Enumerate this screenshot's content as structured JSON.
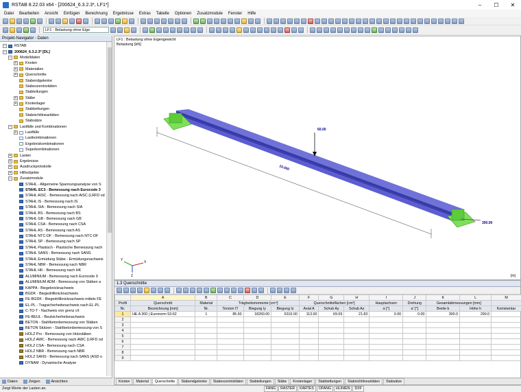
{
  "window": {
    "title": "RSTAB 8.22.03 x64 - [200624_6.3.2.3*, LF1*]",
    "minimize": "–",
    "maximize": "☐",
    "close": "✕"
  },
  "menu": [
    "Datei",
    "Bearbeiten",
    "Ansicht",
    "Einfügen",
    "Berechnung",
    "Ergebnisse",
    "Extras",
    "Tabelle",
    "Optionen",
    "Zusatzmodule",
    "Fenster",
    "Hilfe"
  ],
  "toolbar": {
    "loadcase": "LF1 - Belastung ohne Eige"
  },
  "navigator": {
    "title": "Projekt-Navigator - Daten",
    "tree": [
      {
        "label": "RSTAB",
        "lvl": 0,
        "ic": "m",
        "ex": "−"
      },
      {
        "label": "200624_6.3.2.3* [DL]",
        "lvl": 0,
        "ic": "m",
        "ex": "−",
        "b": true
      },
      {
        "label": "Modelldaten",
        "lvl": 1,
        "ic": "f",
        "ex": "−"
      },
      {
        "label": "Knoten",
        "lvl": 2,
        "ic": "f",
        "ex": "+"
      },
      {
        "label": "Materialien",
        "lvl": 2,
        "ic": "f",
        "ex": "+"
      },
      {
        "label": "Querschnitte",
        "lvl": 2,
        "ic": "f",
        "ex": "+"
      },
      {
        "label": "Stabendgelenke",
        "lvl": 2,
        "ic": "f"
      },
      {
        "label": "Stabexzentrizitäten",
        "lvl": 2,
        "ic": "f"
      },
      {
        "label": "Stabteilungen",
        "lvl": 2,
        "ic": "f"
      },
      {
        "label": "Stäbe",
        "lvl": 2,
        "ic": "f",
        "ex": "+"
      },
      {
        "label": "Knotenlager",
        "lvl": 2,
        "ic": "f",
        "ex": "+"
      },
      {
        "label": "Stabbettungen",
        "lvl": 2,
        "ic": "f"
      },
      {
        "label": "Stabnichtlinearitäten",
        "lvl": 2,
        "ic": "f"
      },
      {
        "label": "Stabsätze",
        "lvl": 2,
        "ic": "f"
      },
      {
        "label": "Lastfälle und Kombinationen",
        "lvl": 1,
        "ic": "f",
        "ex": "−"
      },
      {
        "label": "Lastfälle",
        "lvl": 2,
        "ic": "d",
        "ex": "+"
      },
      {
        "label": "Lastkombinationen",
        "lvl": 2,
        "ic": "d"
      },
      {
        "label": "Ergebniskombinationen",
        "lvl": 2,
        "ic": "d"
      },
      {
        "label": "Superkombinationen",
        "lvl": 2,
        "ic": "d"
      },
      {
        "label": "Lasten",
        "lvl": 1,
        "ic": "f",
        "ex": "+"
      },
      {
        "label": "Ergebnisse",
        "lvl": 1,
        "ic": "f",
        "ex": "+"
      },
      {
        "label": "Ausdruckprotokolle",
        "lvl": 1,
        "ic": "f",
        "ex": "+"
      },
      {
        "label": "Hilfsobjekte",
        "lvl": 1,
        "ic": "f",
        "ex": "+"
      },
      {
        "label": "Zusatzmodule",
        "lvl": 1,
        "ic": "f",
        "ex": "−"
      },
      {
        "label": "STAHL - Allgemeine Spannungsanalyse von S",
        "lvl": 2,
        "ic": "m"
      },
      {
        "label": "STAHL EC3 - Bemessung nach Eurocode 3",
        "lvl": 2,
        "ic": "m",
        "b": true
      },
      {
        "label": "STAHL AISC - Bemessung nach AISC (LRFD od",
        "lvl": 2,
        "ic": "m"
      },
      {
        "label": "STAHL IS - Bemessung nach IS",
        "lvl": 2,
        "ic": "m"
      },
      {
        "label": "STAHL SIA - Bemessung nach SIA",
        "lvl": 2,
        "ic": "m"
      },
      {
        "label": "STAHL BS - Bemessung nach BS",
        "lvl": 2,
        "ic": "m"
      },
      {
        "label": "STAHL GB - Bemessung nach GB",
        "lvl": 2,
        "ic": "m"
      },
      {
        "label": "STAHL CSA - Bemessung nach CSA",
        "lvl": 2,
        "ic": "m"
      },
      {
        "label": "STAHL AS - Bemessung nach AS",
        "lvl": 2,
        "ic": "m"
      },
      {
        "label": "STAHL NTC-DF - Bemessung nach NTC-DF",
        "lvl": 2,
        "ic": "m"
      },
      {
        "label": "STAHL SP - Bemessung nach SP",
        "lvl": 2,
        "ic": "m"
      },
      {
        "label": "STAHL Plastisch - Plastische Bemessung nach",
        "lvl": 2,
        "ic": "m"
      },
      {
        "label": "STAHL SANS - Bemessung nach SANS",
        "lvl": 2,
        "ic": "m"
      },
      {
        "label": "STAHL Ermüdung Stäbe - Ermüdungsnachweis",
        "lvl": 2,
        "ic": "m"
      },
      {
        "label": "STAHL NBR - Bemessung nach NBR",
        "lvl": 2,
        "ic": "m"
      },
      {
        "label": "STAHL HK - Bemessung nach HK",
        "lvl": 2,
        "ic": "m"
      },
      {
        "label": "ALUMINIUM - Bemessung nach Eurocode 9",
        "lvl": 2,
        "ic": "m"
      },
      {
        "label": "ALUMINIUM ADM - Bemessung von Stäben a",
        "lvl": 2,
        "ic": "m"
      },
      {
        "label": "KAPPA - Biegeknicknachweis",
        "lvl": 2,
        "ic": "m"
      },
      {
        "label": "BGDK - Biegedrillknicknachweis",
        "lvl": 2,
        "ic": "m"
      },
      {
        "label": "FE-BGDK - Biegedrillknicknachweis mittels FE",
        "lvl": 2,
        "ic": "m"
      },
      {
        "label": "EL-PL - Tragsicherheitsnachweis nach EL-PL",
        "lvl": 2,
        "ic": "m"
      },
      {
        "label": "C-TO-T - Nachweis von grenz c/t",
        "lvl": 2,
        "ic": "m"
      },
      {
        "label": "FE-BEUL - Beulsicherheitsnachweis",
        "lvl": 2,
        "ic": "m"
      },
      {
        "label": "BETON - Stahlbetonbemessung von Stäben",
        "lvl": 2,
        "ic": "m"
      },
      {
        "label": "BETON Stützen - Stahlbetonbemessung von S",
        "lvl": 2,
        "ic": "m"
      },
      {
        "label": "HOLZ Pro - Bemessung von Holzstäben",
        "lvl": 2,
        "ic": "p"
      },
      {
        "label": "HOLZ AWC - Bemessung nach AWC (LRFD od",
        "lvl": 2,
        "ic": "p"
      },
      {
        "label": "HOLZ CSA - Bemessung nach CSA",
        "lvl": 2,
        "ic": "p"
      },
      {
        "label": "HOLZ NBR - Bemessung nach NBR",
        "lvl": 2,
        "ic": "p"
      },
      {
        "label": "HOLZ SANS - Bemessung nach SANS (ASD o",
        "lvl": 2,
        "ic": "p"
      },
      {
        "label": "DYNAM - Dynamische Analyse",
        "lvl": 2,
        "ic": "m"
      }
    ],
    "tabs": [
      "Daten",
      "Zeigen",
      "Ansichten"
    ]
  },
  "view": {
    "line1": "LF1 : Belastung ohne Eigengewicht",
    "line2": "Belastung [kN]",
    "load_p": "60.00",
    "dim": "10.000",
    "load_end": "300.00",
    "unit": "[m]",
    "axis_x": "X",
    "axis_y": "Y",
    "axis_z": "Z"
  },
  "panel": {
    "title": "1.3 Querschnitte",
    "col_letters": [
      "A",
      "B",
      "C",
      "D",
      "E",
      "F",
      "G",
      "H",
      "I",
      "J",
      "K",
      "L",
      "M"
    ],
    "head1": [
      "Profil",
      "Querschnitt",
      "Material",
      "Trägheitsmomente [cm⁴]",
      "Querschnittsflächen [cm²]",
      "Hauptachsen",
      "Drehung",
      "Gesamtabmessungen [mm]",
      ""
    ],
    "head2": [
      "Nr.",
      "Bezeichnung [mm]",
      "Nr.",
      "Torsion IT",
      "Biegung Iy",
      "Biegung Iz",
      "Axial A",
      "Schub Ay",
      "Schub Az",
      "α [°]",
      "α' [°]",
      "Breite b",
      "Höhe h",
      "Kommentar"
    ],
    "rows": [
      [
        "1",
        "HE A 300 | Euronorm 53-62",
        "1",
        "85.60",
        "18260.00",
        "6310.00",
        "113.00",
        "69.09",
        "21.83",
        "0.00",
        "0.00",
        "300.0",
        "290.0",
        ""
      ],
      [
        "2",
        "",
        "",
        "",
        "",
        "",
        "",
        "",
        "",
        "",
        "",
        "",
        "",
        ""
      ],
      [
        "3",
        "",
        "",
        "",
        "",
        "",
        "",
        "",
        "",
        "",
        "",
        "",
        "",
        ""
      ],
      [
        "4",
        "",
        "",
        "",
        "",
        "",
        "",
        "",
        "",
        "",
        "",
        "",
        "",
        ""
      ],
      [
        "5",
        "",
        "",
        "",
        "",
        "",
        "",
        "",
        "",
        "",
        "",
        "",
        "",
        ""
      ],
      [
        "6",
        "",
        "",
        "",
        "",
        "",
        "",
        "",
        "",
        "",
        "",
        "",
        "",
        ""
      ],
      [
        "7",
        "",
        "",
        "",
        "",
        "",
        "",
        "",
        "",
        "",
        "",
        "",
        "",
        ""
      ],
      [
        "8",
        "",
        "",
        "",
        "",
        "",
        "",
        "",
        "",
        "",
        "",
        "",
        "",
        ""
      ],
      [
        "9",
        "",
        "",
        "",
        "",
        "",
        "",
        "",
        "",
        "",
        "",
        "",
        "",
        ""
      ]
    ],
    "tabs": [
      "Knoten",
      "Material",
      "Querschnitte",
      "Stabendgelenke",
      "Stabexzentrizitäten",
      "Stabteilungen",
      "Stäbe",
      "Knotenlager",
      "Stabbettungen",
      "Stabnichtlinearitäten",
      "Stabsätze"
    ],
    "active_tab": "Querschnitte"
  },
  "status": {
    "text": "Zeigt Werte der Lasten an.",
    "buttons": [
      "FANG",
      "RASTER",
      "KARTES",
      "OFANG",
      "HLINIEN",
      "DXF"
    ]
  }
}
